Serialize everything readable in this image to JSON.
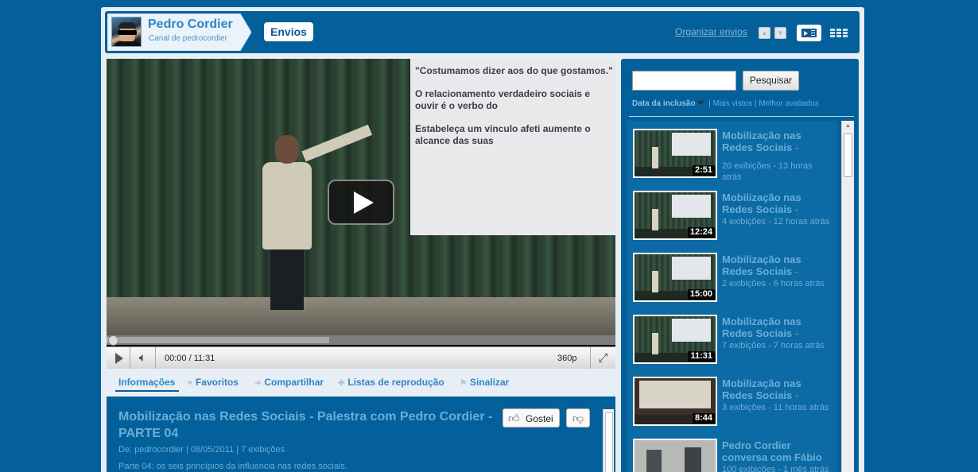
{
  "channel": {
    "name": "Pedro Cordier",
    "subtitle": "Canal de pedrocordier"
  },
  "header": {
    "active_tab": "Envios",
    "organize_link": "Organizar envios"
  },
  "player": {
    "slide_lines": [
      "\"Costumamos dizer aos do que gostamos.\"",
      "O relacionamento verdadeiro sociais e ouvir é o verbo do",
      "Estabeleça um vínculo afeti aumente o alcance das suas"
    ],
    "time_display": "00:00 / 11:31",
    "quality": "360p"
  },
  "info_tabs": [
    {
      "label": "Informações",
      "icon": "none",
      "active": true
    },
    {
      "label": "Favoritos",
      "icon": "heart-icon",
      "active": false
    },
    {
      "label": "Compartilhar",
      "icon": "share-arrow-icon",
      "active": false
    },
    {
      "label": "Listas de reprodução",
      "icon": "plus-icon",
      "active": false
    },
    {
      "label": "Sinalizar",
      "icon": "flag-icon",
      "active": false
    }
  ],
  "video_info": {
    "title": "Mobilização nas Redes Sociais - Palestra com Pedro Cordier - PARTE 04",
    "like_label": "Gostei",
    "meta": "De: pedrocordier  | 08/05/2011  | 7 exibições",
    "description": "Parte 04: os seis princípios da influencia nas redes sociais."
  },
  "sidebar": {
    "search_value": "",
    "search_button": "Pesquisar",
    "sort_active": "Data da inclusão",
    "sort_options": [
      "Mais vistos",
      "Melhor avaliados"
    ],
    "videos": [
      {
        "title": "Mobilização nas Redes Sociais",
        "duration": "2:51",
        "meta": "20 exibições - 13 horas atrás"
      },
      {
        "title": "Mobilização nas Redes Sociais",
        "duration": "12:24",
        "meta": "4 exibições - 12 horas atrás"
      },
      {
        "title": "Mobilização nas Redes Sociais",
        "duration": "15:00",
        "meta": "2 exibições - 6 horas atrás"
      },
      {
        "title": "Mobilização nas Redes Sociais",
        "duration": "11:31",
        "meta": "7 exibições - 7 horas atrás"
      },
      {
        "title": "Mobilização nas Redes Sociais",
        "duration": "8:44",
        "meta": "3 exibições - 11 horas atrás"
      },
      {
        "title": "Pedro Cordier conversa com Fábio",
        "duration": "",
        "meta": "100 exibições - 1 mês atrás"
      }
    ]
  }
}
